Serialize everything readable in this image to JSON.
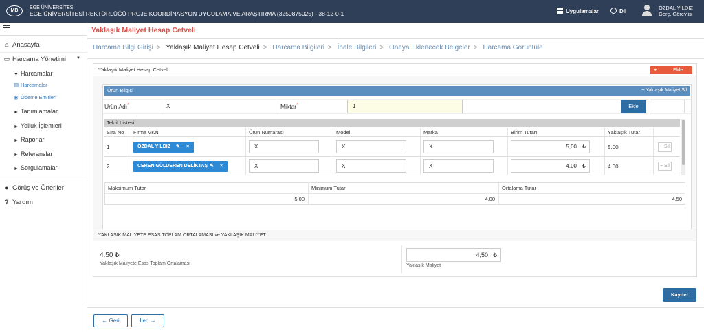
{
  "header": {
    "logo": "MB",
    "univ_line1": "EGE ÜNİVERSİTESİ",
    "univ_line2": "EGE ÜNİVERSİTESİ REKTÖRLÜĞÜ PROJE KOORDİNASYON UYGULAMA VE ARAŞTIRMA (3250875025) - 38-12-0-1",
    "apps": "Uygulamalar",
    "lang": "Dil",
    "user_name": "ÖZDAL YILDIZ",
    "user_role": "Gerç. Görevlisi"
  },
  "sidebar": {
    "home": "Anasayfa",
    "harcama_yonetimi": "Harcama Yönetimi",
    "harcamalar": "Harcamalar",
    "harcamalar_sub": "Harcamalar",
    "odeme_emirleri": "Ödeme Emirleri",
    "tanimlamalar": "Tanımlamalar",
    "yolluk": "Yolluk İşlemleri",
    "raporlar": "Raporlar",
    "referanslar": "Referanslar",
    "sorgulamalar": "Sorgulamalar",
    "gorus": "Görüş ve Öneriler",
    "yardim": "Yardım"
  },
  "page": {
    "title": "Yaklaşık Maliyet Hesap Cetveli"
  },
  "breadcrumb": [
    "Harcama Bilgi Girişi",
    "Yaklaşık Maliyet Hesap Cetveli",
    "Harcama Bilgileri",
    "İhale Bilgileri",
    "Onaya Eklenecek Belgeler",
    "Harcama Görüntüle"
  ],
  "cetvel": {
    "heading": "Yaklaşık Maliyet Hesap Cetveli",
    "add_label": "Ekle"
  },
  "urun": {
    "heading": "Ürün Bilgisi",
    "remove_label": "Yaklaşık Maliyet Sil",
    "name_label": "Ürün Adı",
    "name_value": "X",
    "qty_label": "Miktar",
    "qty_value": "1",
    "add_label": "Ekle"
  },
  "teklif": {
    "heading": "Teklif Listesi",
    "columns": [
      "Sıra No",
      "Firma VKN",
      "Ürün Numarası",
      "Model",
      "Marka",
      "Birim Tutarı",
      "Yaklaşık Tutar"
    ],
    "rows": [
      {
        "no": "1",
        "firm": "ÖZDAL YILDIZ",
        "urun_no": "X",
        "model": "X",
        "marka": "X",
        "birim": "5,00",
        "yaklasik": "5.00",
        "sil": "Sil"
      },
      {
        "no": "2",
        "firm": "CEREN GÜLDEREN DELİKTAŞ",
        "urun_no": "X",
        "model": "X",
        "marka": "X",
        "birim": "4,00",
        "yaklasik": "4.00",
        "sil": "Sil"
      }
    ]
  },
  "summary": {
    "max_label": "Maksimum Tutar",
    "max_value": "5.00",
    "min_label": "Minimum Tutar",
    "min_value": "4.00",
    "avg_label": "Ortalama Tutar",
    "avg_value": "4.50"
  },
  "totals": {
    "heading": "YAKLAŞIK MALİYETE ESAS TOPLAM ORTALAMASI ve YAKLAŞIK MALİYET",
    "avg_value": "4.50",
    "avg_caption": "Yaklaşık Maliyete Esas Toplam Ortalaması",
    "ym_value": "4,50",
    "ym_caption": "Yaklaşık Maliyet"
  },
  "currency": "₺",
  "buttons": {
    "save": "Kaydet",
    "back": "Geri",
    "next": "İleri"
  },
  "colors": {
    "topbar": "#2f3f57",
    "accent_red": "#d9534f",
    "primary_blue": "#2e6da4",
    "section_blue": "#5b8fc0",
    "firm_blue": "#2f8ad6"
  }
}
